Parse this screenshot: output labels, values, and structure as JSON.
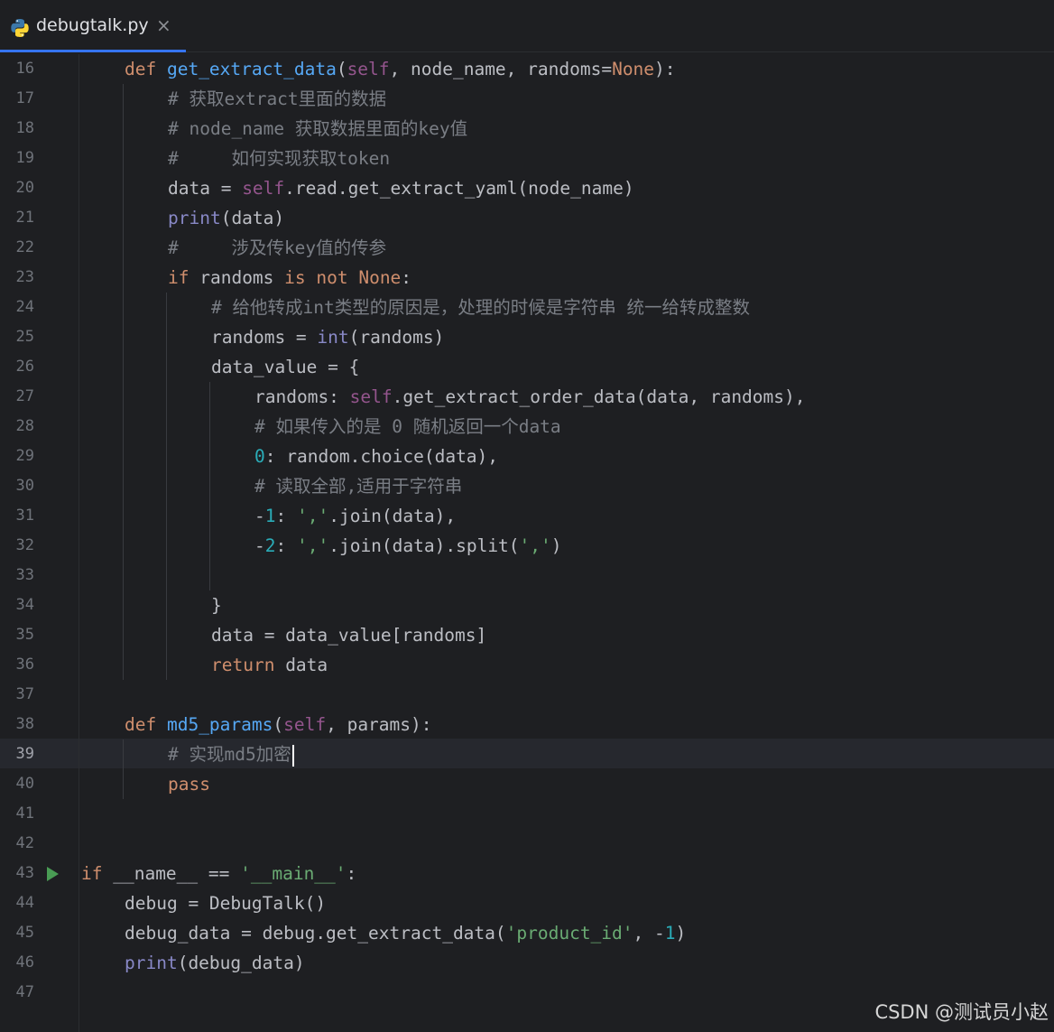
{
  "tab": {
    "filename": "debugtalk.py",
    "close_glyph": "×",
    "icon": "python-icon"
  },
  "current_line": 39,
  "editor_lines": [
    {
      "n": 16,
      "indent": 1,
      "tokens": [
        [
          "kw",
          "def "
        ],
        [
          "fn",
          "get_extract_data"
        ],
        [
          "",
          "("
        ],
        [
          "sf",
          "self"
        ],
        [
          "",
          ", node_name, randoms="
        ],
        [
          "kw",
          "None"
        ],
        [
          "",
          "):"
        ]
      ]
    },
    {
      "n": 17,
      "indent": 2,
      "tokens": [
        [
          "cm",
          "# 获取extract里面的数据"
        ]
      ]
    },
    {
      "n": 18,
      "indent": 2,
      "tokens": [
        [
          "cm",
          "# node_name 获取数据里面的key值"
        ]
      ]
    },
    {
      "n": 19,
      "indent": 2,
      "tokens": [
        [
          "cm",
          "#     如何实现获取token"
        ]
      ]
    },
    {
      "n": 20,
      "indent": 2,
      "tokens": [
        [
          "",
          "data = "
        ],
        [
          "sf",
          "self"
        ],
        [
          "",
          ".read.get_extract_yaml(node_name)"
        ]
      ]
    },
    {
      "n": 21,
      "indent": 2,
      "tokens": [
        [
          "bi",
          "print"
        ],
        [
          "",
          "(data)"
        ]
      ]
    },
    {
      "n": 22,
      "indent": 2,
      "tokens": [
        [
          "cm",
          "#     涉及传key值的传参"
        ]
      ]
    },
    {
      "n": 23,
      "indent": 2,
      "tokens": [
        [
          "kw",
          "if "
        ],
        [
          "",
          "randoms "
        ],
        [
          "kw",
          "is not None"
        ],
        [
          "",
          ":"
        ]
      ]
    },
    {
      "n": 24,
      "indent": 3,
      "tokens": [
        [
          "cm",
          "# 给他转成int类型的原因是，处理的时候是字符串 统一给转成整数"
        ]
      ]
    },
    {
      "n": 25,
      "indent": 3,
      "tokens": [
        [
          "",
          "randoms = "
        ],
        [
          "bi",
          "int"
        ],
        [
          "",
          "(randoms)"
        ]
      ]
    },
    {
      "n": 26,
      "indent": 3,
      "tokens": [
        [
          "",
          "data_value = {"
        ]
      ]
    },
    {
      "n": 27,
      "indent": 4,
      "tokens": [
        [
          "",
          "randoms: "
        ],
        [
          "sf",
          "self"
        ],
        [
          "",
          ".get_extract_order_data(data, randoms),"
        ]
      ]
    },
    {
      "n": 28,
      "indent": 4,
      "tokens": [
        [
          "cm",
          "# 如果传入的是 0 随机返回一个data"
        ]
      ]
    },
    {
      "n": 29,
      "indent": 4,
      "tokens": [
        [
          "nm",
          "0"
        ],
        [
          "",
          ": random.choice(data),"
        ]
      ]
    },
    {
      "n": 30,
      "indent": 4,
      "tokens": [
        [
          "cm",
          "# 读取全部,适用于字符串"
        ]
      ]
    },
    {
      "n": 31,
      "indent": 4,
      "tokens": [
        [
          "",
          "-"
        ],
        [
          "nm",
          "1"
        ],
        [
          "",
          ": "
        ],
        [
          "st",
          "','"
        ],
        [
          "",
          ".join(data),"
        ]
      ]
    },
    {
      "n": 32,
      "indent": 4,
      "tokens": [
        [
          "",
          "-"
        ],
        [
          "nm",
          "2"
        ],
        [
          "",
          ": "
        ],
        [
          "st",
          "','"
        ],
        [
          "",
          ".join(data).split("
        ],
        [
          "st",
          "','"
        ],
        [
          "",
          ")"
        ]
      ]
    },
    {
      "n": 33,
      "indent": 0,
      "tokens": []
    },
    {
      "n": 34,
      "indent": 3,
      "tokens": [
        [
          "",
          "}"
        ]
      ]
    },
    {
      "n": 35,
      "indent": 3,
      "tokens": [
        [
          "",
          "data = data_value[randoms]"
        ]
      ]
    },
    {
      "n": 36,
      "indent": 3,
      "tokens": [
        [
          "kw",
          "return "
        ],
        [
          "",
          "data"
        ]
      ]
    },
    {
      "n": 37,
      "indent": 0,
      "tokens": []
    },
    {
      "n": 38,
      "indent": 1,
      "tokens": [
        [
          "kw",
          "def "
        ],
        [
          "fn",
          "md5_params"
        ],
        [
          "",
          "("
        ],
        [
          "sf",
          "self"
        ],
        [
          "",
          ", params):"
        ]
      ]
    },
    {
      "n": 39,
      "indent": 2,
      "tokens": [
        [
          "cm",
          "# 实现md5加密"
        ]
      ]
    },
    {
      "n": 40,
      "indent": 2,
      "tokens": [
        [
          "kw",
          "pass"
        ]
      ]
    },
    {
      "n": 41,
      "indent": 0,
      "tokens": []
    },
    {
      "n": 42,
      "indent": 0,
      "tokens": []
    },
    {
      "n": 43,
      "indent": 0,
      "tokens": [
        [
          "kw",
          "if "
        ],
        [
          "",
          "__name__ == "
        ],
        [
          "st",
          "'__main__'"
        ],
        [
          "",
          ":"
        ]
      ]
    },
    {
      "n": 44,
      "indent": 1,
      "tokens": [
        [
          "",
          "debug = DebugTalk()"
        ]
      ]
    },
    {
      "n": 45,
      "indent": 1,
      "tokens": [
        [
          "",
          "debug_data = debug.get_extract_data("
        ],
        [
          "st",
          "'product_id'"
        ],
        [
          "",
          ", -"
        ],
        [
          "nm",
          "1"
        ],
        [
          "",
          ")"
        ]
      ]
    },
    {
      "n": 46,
      "indent": 1,
      "tokens": [
        [
          "bi",
          "print"
        ],
        [
          "",
          "(debug_data)"
        ]
      ]
    },
    {
      "n": 47,
      "indent": 0,
      "tokens": []
    }
  ],
  "watermark": "CSDN @测试员小赵",
  "colors": {
    "background": "#1e1f22",
    "keyword": "#cf8e6d",
    "function": "#56a8f5",
    "self": "#94558d",
    "builtin": "#8888c6",
    "comment": "#7a7e85",
    "string": "#6aab73",
    "number": "#2aacb8",
    "tab_underline": "#3574f0"
  }
}
